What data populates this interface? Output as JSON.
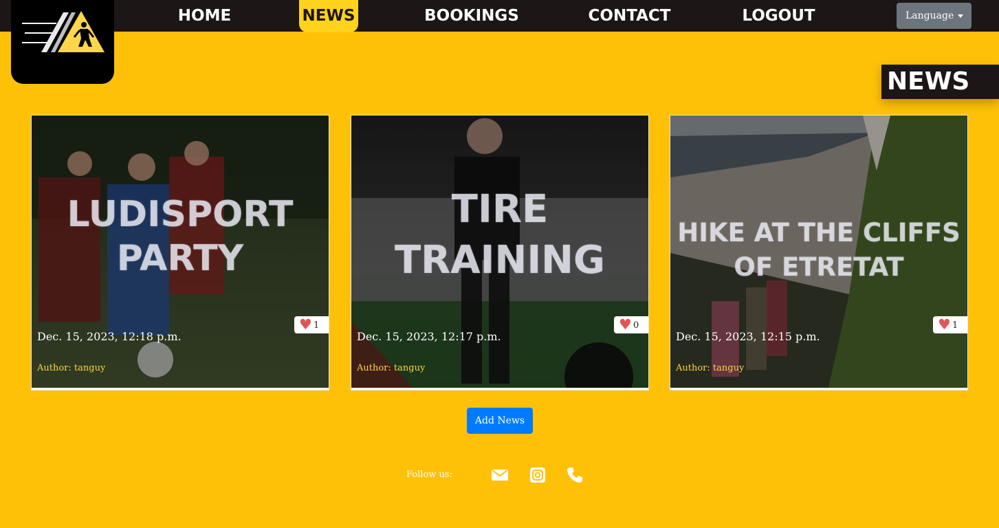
{
  "nav": {
    "items": [
      {
        "label": "HOME"
      },
      {
        "label": "NEWS",
        "active": true
      },
      {
        "label": "BOOKINGS"
      },
      {
        "label": "CONTACT"
      },
      {
        "label": "LOGOUT"
      }
    ],
    "language_label": "Language"
  },
  "page": {
    "heading": "NEWS"
  },
  "news": [
    {
      "title": "LUDISPORT\nPARTY",
      "date": "Dec. 15, 2023, 12:18 p.m.",
      "author": "Author: tanguy",
      "likes": "1"
    },
    {
      "title": "TIRE\nTRAINING",
      "date": "Dec. 15, 2023, 12:17 p.m.",
      "author": "Author: tanguy",
      "likes": "0"
    },
    {
      "title": "HIKE AT THE CLIFFS\nOF ETRETAT",
      "date": "Dec. 15, 2023, 12:15 p.m.",
      "author": "Author: tanguy",
      "likes": "1"
    }
  ],
  "actions": {
    "add_news": "Add News"
  },
  "footer": {
    "follow_label": "Follow us:",
    "icons": [
      "envelope-icon",
      "instagram-icon",
      "phone-icon"
    ]
  },
  "colors": {
    "background": "#ffc107",
    "navbar": "#1d1616",
    "active_nav": "#ffd21e",
    "button_primary": "#007bff",
    "author_text": "#ffd43b",
    "heart": "#e05656"
  }
}
